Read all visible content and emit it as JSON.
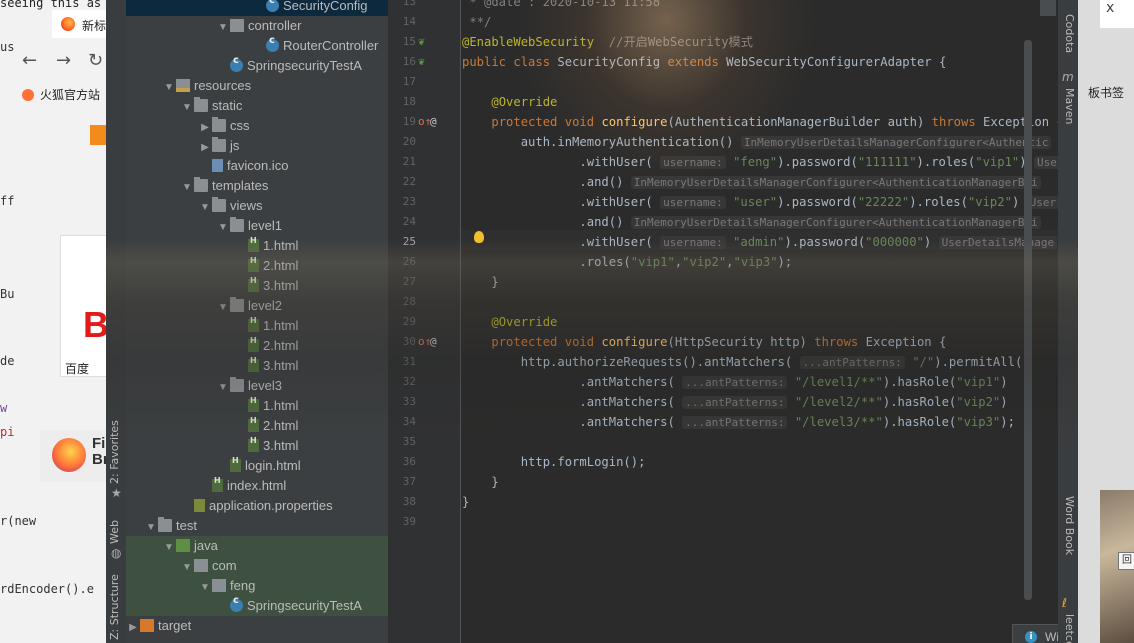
{
  "background_browser": {
    "title_text": "seeing this as",
    "tab_label": "新标",
    "bookmark_label": "火狐官方站",
    "fragments": [
      "us",
      "ff",
      "Bu",
      "de",
      "w",
      "pi",
      "r(new",
      "rdEncoder().e"
    ],
    "baidu_logo": "B",
    "baidu_label": "百度",
    "firefox_text": [
      "Fi",
      "Br"
    ]
  },
  "left_tool_strip": {
    "favorites": "2: Favorites",
    "web": "Web",
    "structure": "Z: Structure"
  },
  "project_tree": [
    {
      "indent": 9,
      "arrow": "",
      "icon": "java",
      "label": "SecurityConfig",
      "selected": true
    },
    {
      "indent": 7,
      "arrow": "▼",
      "icon": "pkg",
      "label": "controller"
    },
    {
      "indent": 9,
      "arrow": "",
      "icon": "java",
      "label": "RouterController"
    },
    {
      "indent": 7,
      "arrow": "",
      "icon": "java",
      "label": "SpringsecurityTestA"
    },
    {
      "indent": 4,
      "arrow": "▼",
      "icon": "res",
      "label": "resources"
    },
    {
      "indent": 5,
      "arrow": "▼",
      "icon": "folder",
      "label": "static"
    },
    {
      "indent": 6,
      "arrow": "▶",
      "icon": "folder",
      "label": "css"
    },
    {
      "indent": 6,
      "arrow": "▶",
      "icon": "folder",
      "label": "js"
    },
    {
      "indent": 6,
      "arrow": "",
      "icon": "favicon",
      "label": "favicon.ico"
    },
    {
      "indent": 5,
      "arrow": "▼",
      "icon": "folder",
      "label": "templates"
    },
    {
      "indent": 6,
      "arrow": "▼",
      "icon": "folder",
      "label": "views"
    },
    {
      "indent": 7,
      "arrow": "▼",
      "icon": "folder",
      "label": "level1"
    },
    {
      "indent": 8,
      "arrow": "",
      "icon": "html",
      "label": "1.html"
    },
    {
      "indent": 8,
      "arrow": "",
      "icon": "html",
      "label": "2.html"
    },
    {
      "indent": 8,
      "arrow": "",
      "icon": "html",
      "label": "3.html"
    },
    {
      "indent": 7,
      "arrow": "▼",
      "icon": "folder",
      "label": "level2"
    },
    {
      "indent": 8,
      "arrow": "",
      "icon": "html",
      "label": "1.html"
    },
    {
      "indent": 8,
      "arrow": "",
      "icon": "html",
      "label": "2.html"
    },
    {
      "indent": 8,
      "arrow": "",
      "icon": "html",
      "label": "3.html"
    },
    {
      "indent": 7,
      "arrow": "▼",
      "icon": "folder",
      "label": "level3"
    },
    {
      "indent": 8,
      "arrow": "",
      "icon": "html",
      "label": "1.html"
    },
    {
      "indent": 8,
      "arrow": "",
      "icon": "html",
      "label": "2.html"
    },
    {
      "indent": 8,
      "arrow": "",
      "icon": "html",
      "label": "3.html"
    },
    {
      "indent": 7,
      "arrow": "",
      "icon": "html",
      "label": "login.html"
    },
    {
      "indent": 6,
      "arrow": "",
      "icon": "html",
      "label": "index.html"
    },
    {
      "indent": 5,
      "arrow": "",
      "icon": "props",
      "label": "application.properties"
    },
    {
      "indent": 3,
      "arrow": "▼",
      "icon": "folder",
      "label": "test"
    },
    {
      "indent": 4,
      "arrow": "▼",
      "icon": "src",
      "label": "java",
      "test_hl": true
    },
    {
      "indent": 5,
      "arrow": "▼",
      "icon": "pkg",
      "label": "com",
      "test_hl": true
    },
    {
      "indent": 6,
      "arrow": "▼",
      "icon": "pkg",
      "label": "feng",
      "test_hl": true
    },
    {
      "indent": 7,
      "arrow": "",
      "icon": "java",
      "label": "SpringsecurityTestA",
      "test_hl": true
    },
    {
      "indent": 2,
      "arrow": "▶",
      "icon": "target",
      "label": "target"
    }
  ],
  "editor": {
    "current_line": "25",
    "lines": [
      {
        "n": "13",
        "html": "<span class='cm'> * @date : 2020-10-13 11:58</span>"
      },
      {
        "n": "14",
        "html": "<span class='cm'> **/</span>"
      },
      {
        "n": "15",
        "html": "<span class='an'>@EnableWebSecurity</span>  <span class='cm'>//开启WebSecurity模式</span>"
      },
      {
        "n": "16",
        "html": "<span class='kw'>public class</span> SecurityConfig <span class='kw'>extends</span> WebSecurityConfigurerAdapter {"
      },
      {
        "n": "17",
        "html": ""
      },
      {
        "n": "18",
        "html": "    <span class='an'>@Override</span>"
      },
      {
        "n": "19",
        "html": "    <span class='kw'>protected void</span> <span class='fn'>configure</span>(AuthenticationManagerBuilder auth) <span class='kw'>throws</span> Exception {"
      },
      {
        "n": "20",
        "html": "        auth.inMemoryAuthentication() <span class='hint'>InMemoryUserDetailsManagerConfigurer&lt;Authentic</span>"
      },
      {
        "n": "21",
        "html": "                .withUser( <span class='hint'>username:</span> <span class='str'>\"feng\"</span>).password(<span class='str'>\"111111\"</span>).roles(<span class='str'>\"vip1\"</span>) <span class='hint'>User</span>"
      },
      {
        "n": "22",
        "html": "                .and() <span class='hint'>InMemoryUserDetailsManagerConfigurer&lt;AuthenticationManagerBui</span>"
      },
      {
        "n": "23",
        "html": "                .withUser( <span class='hint'>username:</span> <span class='str'>\"user\"</span>).password(<span class='str'>\"22222\"</span>).roles(<span class='str'>\"vip2\"</span>) <span class='hint'>User</span>"
      },
      {
        "n": "24",
        "html": "                .and() <span class='hint'>InMemoryUserDetailsManagerConfigurer&lt;AuthenticationManagerBui</span>"
      },
      {
        "n": "25",
        "html": "                .withUser( <span class='hint'>username:</span> <span class='str'>\"admin\"</span>).password(<span class='str'>\"000000\"</span>) <span class='hint'>UserDetailsManage</span>"
      },
      {
        "n": "26",
        "html": "                .roles(<span class='str'>\"vip1\"</span>,<span class='str'>\"vip2\"</span>,<span class='str'>\"vip3\"</span>);"
      },
      {
        "n": "27",
        "html": "    }"
      },
      {
        "n": "28",
        "html": ""
      },
      {
        "n": "29",
        "html": "    <span class='an'>@Override</span>"
      },
      {
        "n": "30",
        "html": "    <span class='kw'>protected void</span> <span class='fn'>configure</span>(HttpSecurity http) <span class='kw'>throws</span> Exception {"
      },
      {
        "n": "31",
        "html": "        http.authorizeRequests().antMatchers( <span class='hint'>...antPatterns:</span> <span class='str'>\"/\"</span>).permitAll()"
      },
      {
        "n": "32",
        "html": "                .antMatchers( <span class='hint'>...antPatterns:</span> <span class='str'>\"/level1/**\"</span>).hasRole(<span class='str'>\"vip1\"</span>)"
      },
      {
        "n": "33",
        "html": "                .antMatchers( <span class='hint'>...antPatterns:</span> <span class='str'>\"/level2/**\"</span>).hasRole(<span class='str'>\"vip2\"</span>)"
      },
      {
        "n": "34",
        "html": "                .antMatchers( <span class='hint'>...antPatterns:</span> <span class='str'>\"/level3/**\"</span>).hasRole(<span class='str'>\"vip3\"</span>);"
      },
      {
        "n": "35",
        "html": ""
      },
      {
        "n": "36",
        "html": "        http.formLogin();"
      },
      {
        "n": "37",
        "html": "    }"
      },
      {
        "n": "38",
        "html": "}"
      },
      {
        "n": "39",
        "html": ""
      }
    ]
  },
  "right_tool_strip": {
    "codota": "Codota",
    "maven": "Maven",
    "word_book": "Word Book",
    "leetcode": "leetco"
  },
  "notification": {
    "text": "Windows Defender configuration updated"
  },
  "desktop_right": {
    "fragments": [
      "x",
      "板书签",
      "回"
    ]
  },
  "colors": {
    "ide_bg": "#2b2b2b",
    "project_bg": "#3c3f41",
    "keyword": "#cc7832",
    "string": "#6a8759",
    "annotation": "#bbb529"
  }
}
